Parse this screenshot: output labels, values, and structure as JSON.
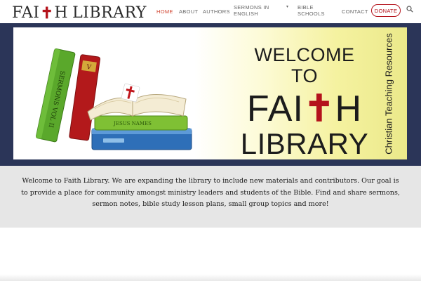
{
  "header": {
    "logo": {
      "part1": "FAI",
      "cross": "✝",
      "part2": "H",
      "part3": "LIBRARY"
    },
    "nav": [
      {
        "label": "HOME",
        "active": true
      },
      {
        "label": "ABOUT",
        "active": false
      },
      {
        "label": "AUTHORS",
        "active": false
      },
      {
        "label_line1": "SERMONS IN",
        "label_line2": "ENGLISH",
        "has_dropdown": true
      },
      {
        "label_line1": "BIBLE",
        "label_line2": "SCHOOLS"
      },
      {
        "label": "CONTACT",
        "active": false
      }
    ],
    "donate_label": "DONATE",
    "search_icon": "search-icon",
    "colors": {
      "active": "#d0432f",
      "brand_red": "#b4121b"
    }
  },
  "banner": {
    "welcome_line1": "WELCOME TO",
    "welcome_fai": "FAI",
    "welcome_cross": "✝",
    "welcome_h": "H",
    "welcome_line3": "LIBRARY",
    "side_text": "Christian Teaching Resources",
    "book_spine_green": "SERMONS VOL II",
    "book_spine_red": "V",
    "book_spine_small": "JESUS NAMES",
    "colors": {
      "frame": "#2b3558"
    }
  },
  "intro": {
    "text": "Welcome to Faith Library. We are expanding the library to include new materials and contributors. Our goal is to provide a place for community amongst ministry leaders and students of the Bible. Find and share sermons, sermon notes, bible study lesson plans, small group topics and more!"
  }
}
